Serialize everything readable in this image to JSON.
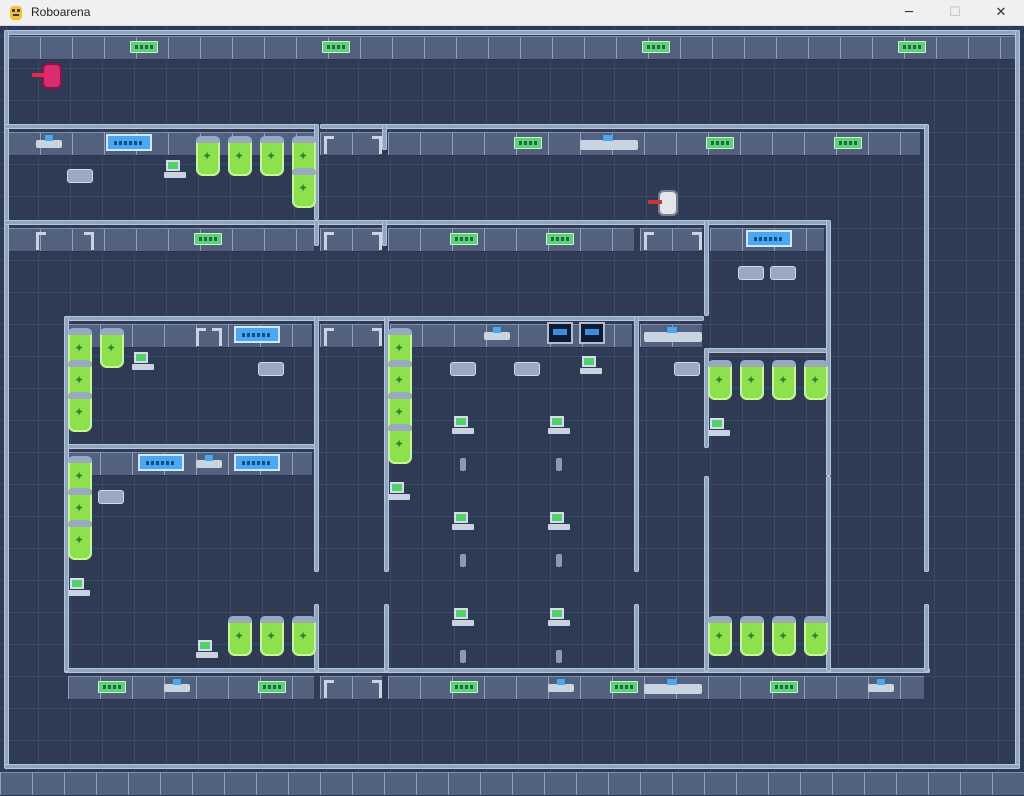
{
  "window": {
    "title": "Roboarena",
    "minimize_glyph": "─",
    "maximize_glyph": "☐",
    "close_glyph": "✕"
  },
  "icons": {
    "app": "python-icon",
    "player_robot": "red-robot-icon",
    "enemy_robot": "white-robot-icon"
  },
  "colors": {
    "floor": "#2f3a55",
    "wall": "#8fa4c0",
    "panel_green": "#62d07a",
    "monitor_blue": "#4aa7f0",
    "tube_green": "#8ee04f",
    "player_robot": "#d92d71",
    "enemy_robot": "#e4e4ea"
  }
}
